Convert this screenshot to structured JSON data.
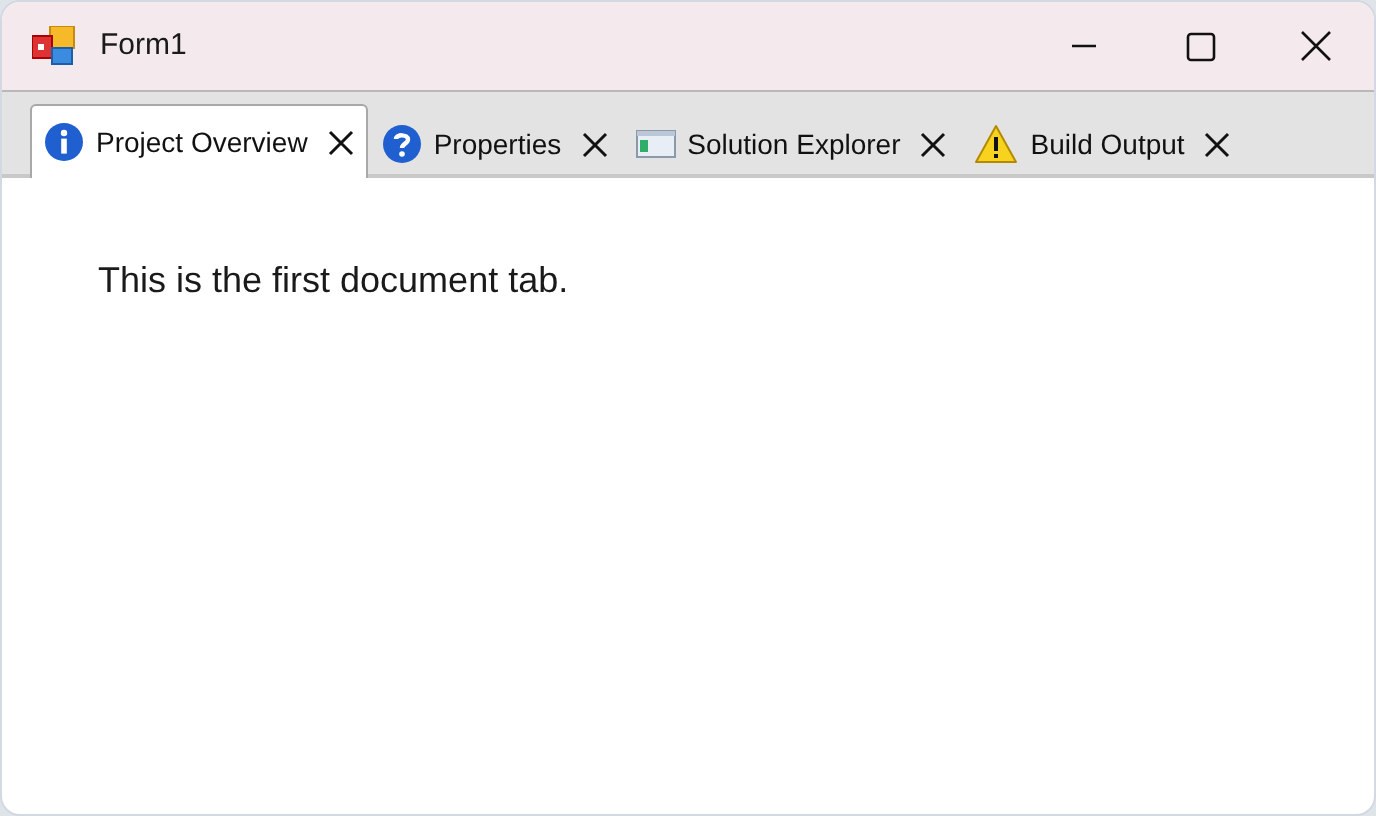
{
  "window": {
    "title": "Form1"
  },
  "tabs": [
    {
      "label": "Project Overview",
      "kind": "info",
      "selected": true
    },
    {
      "label": "Properties",
      "kind": "help",
      "selected": false
    },
    {
      "label": "Solution Explorer",
      "kind": "window",
      "selected": false
    },
    {
      "label": "Build Output",
      "kind": "warning",
      "selected": false
    }
  ],
  "content": {
    "text": "This is the first document tab."
  }
}
